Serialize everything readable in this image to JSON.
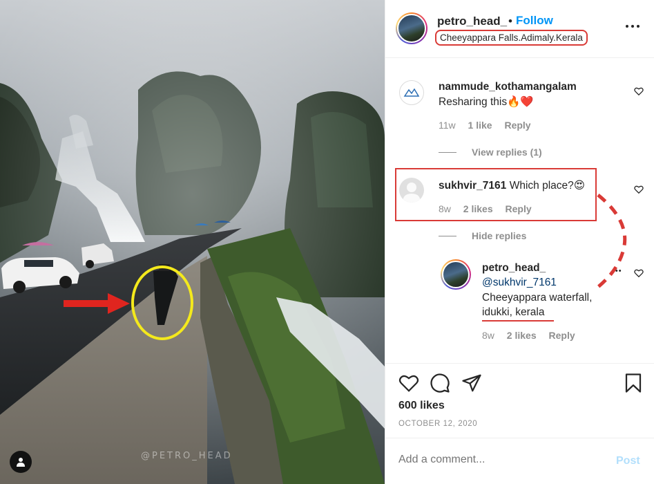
{
  "post": {
    "username": "petro_head_",
    "separator": "•",
    "follow_label": "Follow",
    "location": "Cheeyappara Falls.Adimaly.Kerala",
    "more_icon": "more-horizontal-icon",
    "watermark": "@PETRO_HEAD"
  },
  "comments": [
    {
      "username": "nammude_kothamangalam",
      "text": "Resharing this🔥❤️",
      "age": "11w",
      "likes": "1 like",
      "reply_label": "Reply",
      "toggle_label": "View replies (1)"
    },
    {
      "username": "sukhvir_7161",
      "text": "Which place?😍",
      "age": "8w",
      "likes": "2 likes",
      "reply_label": "Reply",
      "toggle_label": "Hide replies"
    }
  ],
  "reply": {
    "username": "petro_head_",
    "mention": "@sukhvir_7161",
    "line1": "Cheeyappara waterfall,",
    "line2": "idukki, kerala",
    "dots": "•••",
    "age": "8w",
    "likes": "2 likes",
    "reply_label": "Reply"
  },
  "stats": {
    "likes": "600 likes",
    "date": "OCTOBER 12, 2020"
  },
  "composer": {
    "placeholder": "Add a comment...",
    "post_label": "Post"
  },
  "colors": {
    "accent": "#0095f6",
    "annotation_red": "#d93a36",
    "annotation_yellow": "#f4e91c",
    "muted": "#8e8e8e"
  }
}
